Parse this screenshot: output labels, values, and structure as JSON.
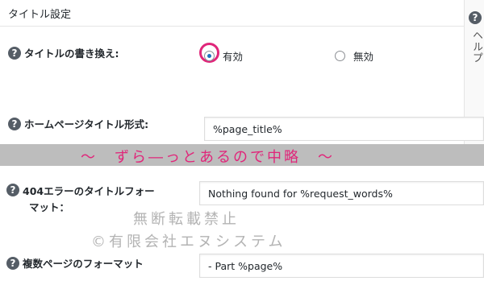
{
  "section": {
    "title": "タイトル設定",
    "help_label": "ヘルプ",
    "help_icon": "?"
  },
  "rows": {
    "title_rewrite": {
      "label": "タイトルの書き換え:",
      "options": [
        "有効",
        "無効"
      ],
      "selected": "有効"
    },
    "home_title_format": {
      "label": "ホームページタイトル形式:",
      "value": "%page_title%"
    },
    "error404_format": {
      "label_line1": "404エラーのタイトルフォー",
      "label_line2": "マット：",
      "value": "Nothing found for %request_words%"
    },
    "paged_format": {
      "label": "複数ページのフォーマット",
      "value": "- Part %page%"
    }
  },
  "omission_banner": "～　ずら―っとあるので中略　～",
  "watermark": {
    "line1": "無断転載禁止",
    "line2": "©有限会社エヌシステム"
  },
  "colors": {
    "highlight": "#e0267a",
    "band": "#bdbdbd"
  }
}
